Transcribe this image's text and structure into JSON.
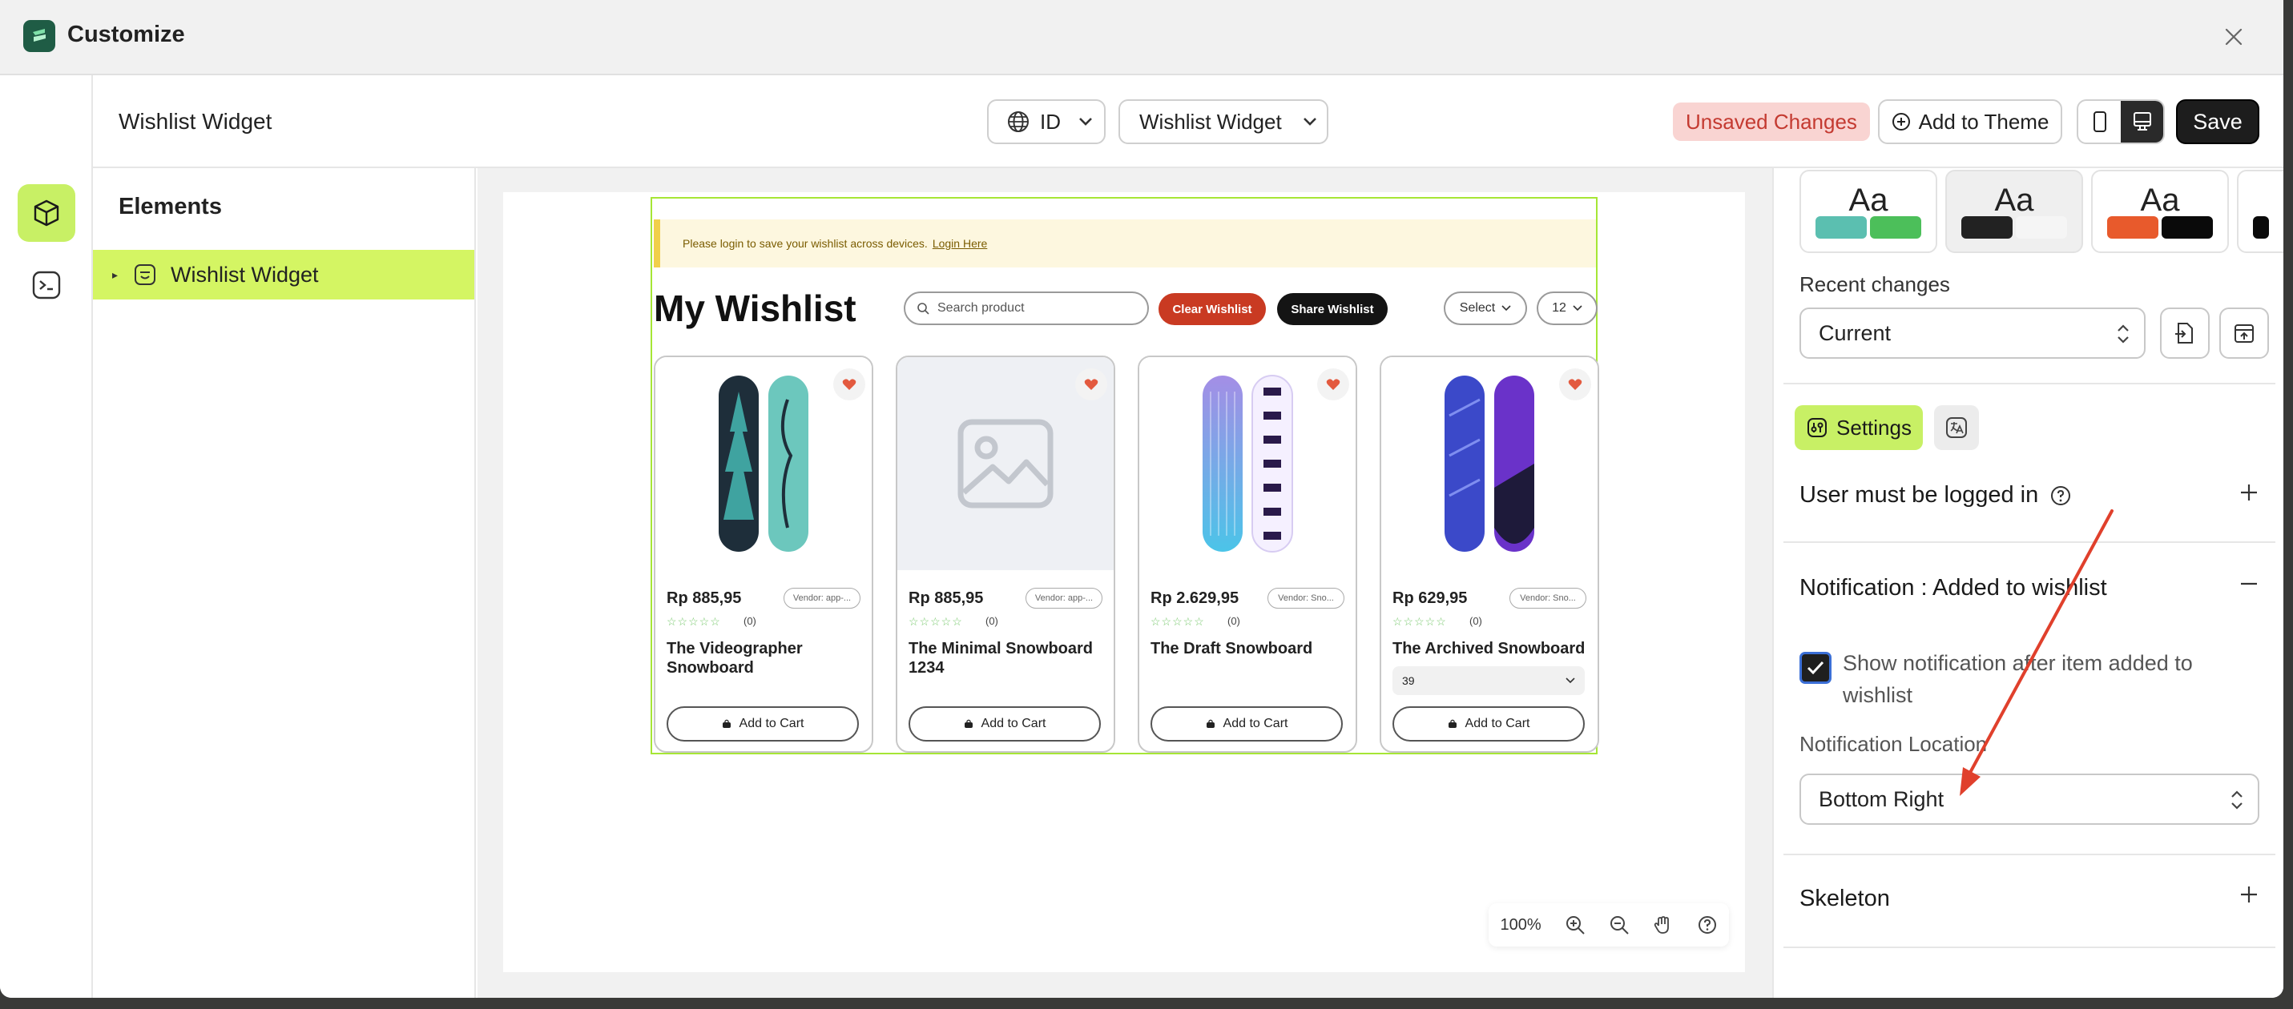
{
  "app": {
    "title": "Customize"
  },
  "toolbar": {
    "page_title": "Wishlist Widget",
    "language": "ID",
    "template_select": "Wishlist Widget",
    "unsaved_label": "Unsaved Changes",
    "add_to_theme_label": "Add to Theme",
    "save_label": "Save"
  },
  "elements": {
    "title": "Elements",
    "items": [
      {
        "label": "Wishlist Widget",
        "selected": true
      }
    ]
  },
  "preview": {
    "notice_text": "Please login to save your wishlist across devices.",
    "notice_link": "Login Here",
    "heading": "My Wishlist",
    "search_placeholder": "Search product",
    "clear_label": "Clear Wishlist",
    "share_label": "Share Wishlist",
    "sort_label": "Select",
    "per_page": "12",
    "products": [
      {
        "price": "Rp 885,95",
        "vendor": "Vendor: app-...",
        "stars": "☆☆☆☆☆",
        "reviews": "(0)",
        "name": "The Videographer Snowboard",
        "variant": "",
        "cart_label": "Add to Cart",
        "image": "snowboard-teal"
      },
      {
        "price": "Rp 885,95",
        "vendor": "Vendor: app-...",
        "stars": "☆☆☆☆☆",
        "reviews": "(0)",
        "name": "The Minimal Snowboard 1234",
        "variant": "",
        "cart_label": "Add to Cart",
        "image": "image-placeholder"
      },
      {
        "price": "Rp 2.629,95",
        "vendor": "Vendor: Sno...",
        "stars": "☆☆☆☆☆",
        "reviews": "(0)",
        "name": "The Draft Snowboard",
        "variant": "",
        "cart_label": "Add to Cart",
        "image": "snowboard-purple"
      },
      {
        "price": "Rp 629,95",
        "vendor": "Vendor: Sno...",
        "stars": "☆☆☆☆☆",
        "reviews": "(0)",
        "name": "The Archived Snowboard",
        "variant": "39",
        "cart_label": "Add to Cart",
        "image": "snowboard-blue"
      }
    ],
    "zoom": "100%"
  },
  "settings": {
    "theme_cards": [
      {
        "label": "Aa",
        "swatches": [
          "#5bbfb0",
          "#4cbf5a"
        ]
      },
      {
        "label": "Aa",
        "swatches": [
          "#222222",
          "#f5f5f5"
        ]
      },
      {
        "label": "Aa",
        "swatches": [
          "#e85a2c",
          "#0a0a0a"
        ]
      }
    ],
    "recent_changes_label": "Recent changes",
    "recent_changes_value": "Current",
    "tab_settings_label": "Settings",
    "section_logged_in": "User must be logged in",
    "section_notification": "Notification : Added to wishlist",
    "checkbox_label": "Show notification after item added to wishlist",
    "checkbox_checked": true,
    "location_label": "Notification Location",
    "location_value": "Bottom Right",
    "section_skeleton": "Skeleton"
  },
  "colors": {
    "accent": "#d4f563",
    "danger": "#c93a22",
    "annotation_arrow": "#e0402c"
  }
}
